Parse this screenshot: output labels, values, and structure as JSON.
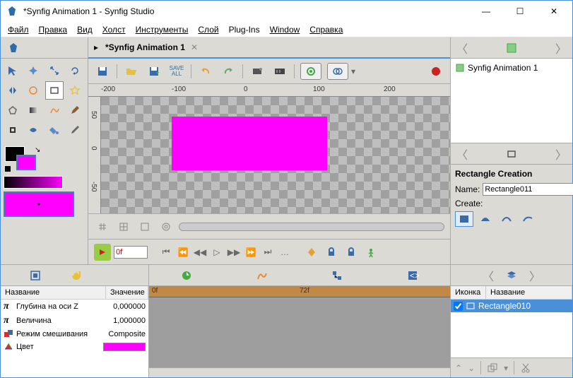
{
  "window": {
    "title": "*Synfig Animation 1 - Synfig Studio"
  },
  "menu": {
    "file": "Файл",
    "edit": "Правка",
    "view": "Вид",
    "canvas": "Холст",
    "tools": "Инструменты",
    "layer": "Слой",
    "plugins": "Plug-Ins",
    "window": "Window",
    "help": "Справка"
  },
  "document": {
    "title": "*Synfig Animation 1"
  },
  "ruler": {
    "h": [
      "-200",
      "-100",
      "0",
      "100",
      "200"
    ],
    "v": [
      "50",
      "0",
      "-50"
    ]
  },
  "saveall": "SAVE ALL",
  "playback": {
    "frame": "0f"
  },
  "files": {
    "item1": "Synfig Animation 1"
  },
  "tool_options": {
    "title": "Rectangle Creation",
    "name_label": "Name:",
    "name_value": "Rectangle011",
    "create_label": "Create:"
  },
  "params": {
    "col_name": "Название",
    "col_value": "Значение",
    "rows": [
      {
        "icon": "π",
        "name": "Глубина на оси Z",
        "value": "0,000000"
      },
      {
        "icon": "π",
        "name": "Величина",
        "value": "1,000000"
      },
      {
        "icon": "blend",
        "name": "Режим смешивания",
        "value": "Composite"
      },
      {
        "icon": "color",
        "name": "Цвет",
        "value": ""
      }
    ]
  },
  "timeline": {
    "start": "0f",
    "mid": "72f"
  },
  "layers": {
    "col_icon": "Иконка",
    "col_name": "Название",
    "item": "Rectangle010"
  }
}
